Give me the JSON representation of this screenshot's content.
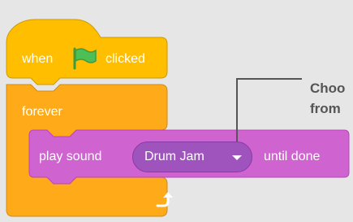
{
  "hat_block": {
    "label_when": "when",
    "flag_icon": "green-flag-icon",
    "label_clicked": "clicked"
  },
  "forever_block": {
    "label": "forever",
    "loop_icon": "loop-arrow-icon"
  },
  "sound_block": {
    "label_play": "play sound",
    "dropdown_value": "Drum Jam",
    "dropdown_icon": "dropdown-caret-icon",
    "label_until": "until done"
  },
  "callout": {
    "line1": "Choo",
    "line2": "from"
  },
  "colors": {
    "events": "#ffbf00",
    "control": "#ffab19",
    "sound": "#cf63cf",
    "background": "#e6e6e6",
    "callout_text": "#555555"
  }
}
